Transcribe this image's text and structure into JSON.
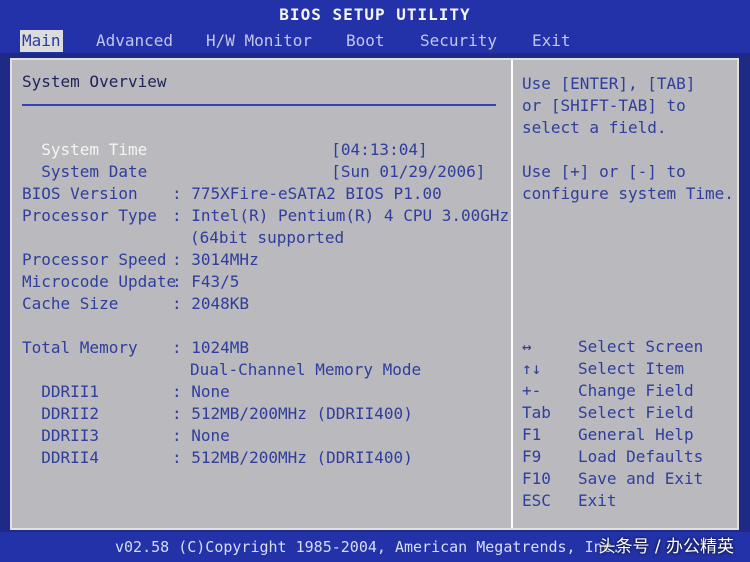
{
  "title": "BIOS SETUP UTILITY",
  "menu": [
    "Main",
    "Advanced",
    "H/W Monitor",
    "Boot",
    "Security",
    "Exit"
  ],
  "section_title": "System Overview",
  "system_time": {
    "label": "System Time",
    "value": "[04:13:04]"
  },
  "system_date": {
    "label": "System Date",
    "value": "[Sun 01/29/2006]"
  },
  "info": [
    {
      "label": "BIOS Version    ",
      "sep": ": ",
      "value": "775XFire-eSATA2 BIOS P1.00"
    },
    {
      "label": "Processor Type  ",
      "sep": ": ",
      "value": "Intel(R) Pentium(R) 4 CPU 3.00GHz"
    },
    {
      "label": "",
      "sep": "",
      "value": "(64bit supported"
    },
    {
      "label": "Processor Speed ",
      "sep": ": ",
      "value": "3014MHz"
    },
    {
      "label": "Microcode Update",
      "sep": ": ",
      "value": "F43/5"
    },
    {
      "label": "Cache Size      ",
      "sep": ": ",
      "value": "2048KB"
    }
  ],
  "memory": [
    {
      "label": "Total Memory    ",
      "sep": ": ",
      "value": "1024MB"
    },
    {
      "label": "",
      "sep": "",
      "value": "Dual-Channel Memory Mode"
    },
    {
      "label": "  DDRII1        ",
      "sep": ": ",
      "value": "None"
    },
    {
      "label": "  DDRII2        ",
      "sep": ": ",
      "value": "512MB/200MHz (DDRII400)"
    },
    {
      "label": "  DDRII3        ",
      "sep": ": ",
      "value": "None"
    },
    {
      "label": "  DDRII4        ",
      "sep": ": ",
      "value": "512MB/200MHz (DDRII400)"
    }
  ],
  "help": [
    "Use [ENTER], [TAB]",
    "or [SHIFT-TAB] to",
    "select a field.",
    "",
    "Use [+] or [-] to",
    "configure system Time."
  ],
  "keys": [
    {
      "key": "↔",
      "desc": "Select Screen"
    },
    {
      "key": "↑↓",
      "desc": "Select Item"
    },
    {
      "key": "+-",
      "desc": "Change Field"
    },
    {
      "key": "Tab",
      "desc": "Select Field"
    },
    {
      "key": "F1",
      "desc": "General Help"
    },
    {
      "key": "F9",
      "desc": "Load Defaults"
    },
    {
      "key": "F10",
      "desc": "Save and Exit"
    },
    {
      "key": "ESC",
      "desc": "Exit"
    }
  ],
  "footer": "v02.58 (C)Copyright 1985-2004, American Megatrends, Inc.",
  "watermark": "头条号 / 办公精英",
  "colors": {
    "background": "#b9b9be",
    "bar": "#2332a8",
    "highlight": "#f5f5f5",
    "text": "#2f3e9c"
  }
}
